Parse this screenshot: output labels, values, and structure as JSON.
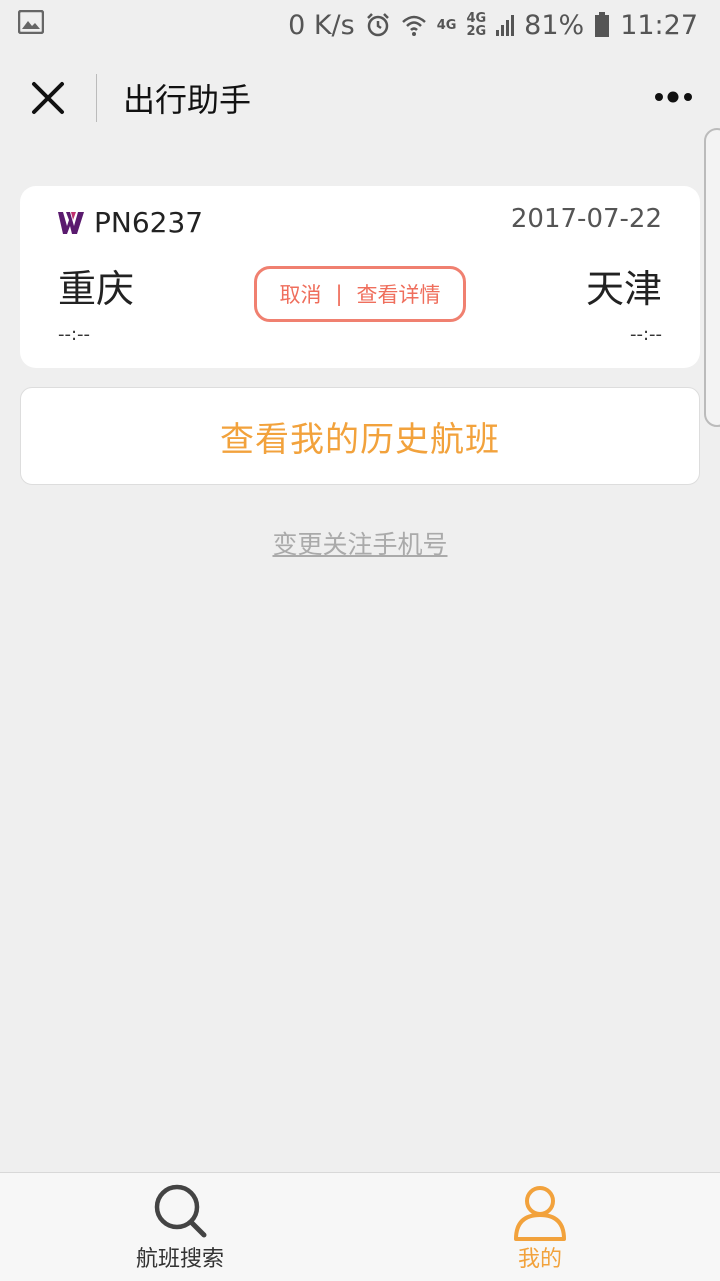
{
  "status_bar": {
    "net_speed": "0 K/s",
    "net_4g": "4G",
    "net_4g2": "4G",
    "net_2g": "2G",
    "battery": "81%",
    "time": "11:27"
  },
  "titlebar": {
    "title": "出行助手"
  },
  "flight_card": {
    "flight_number": "PN6237",
    "date": "2017-07-22",
    "from_city": "重庆",
    "to_city": "天津",
    "from_time": "--:--",
    "to_time": "--:--",
    "cancel_label": "取消",
    "separator": "|",
    "details_label": "查看详情"
  },
  "history_button": {
    "label": "查看我的历史航班"
  },
  "change_phone": {
    "label": "变更关注手机号"
  },
  "tabbar": {
    "search_label": "航班搜索",
    "mine_label": "我的"
  },
  "colors": {
    "accent_orange": "#f2a23c",
    "pill_red": "#ef6e5c",
    "airline_purple": "#5a1a6e"
  }
}
